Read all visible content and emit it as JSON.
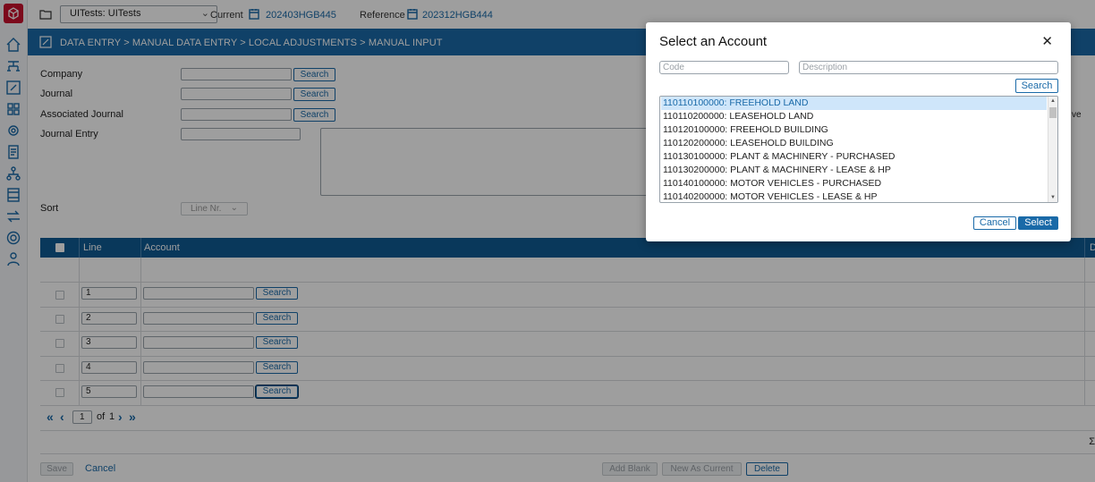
{
  "topbar": {
    "environment": "UITests: UITests",
    "current_label": "Current",
    "current_value": "202403HGB445",
    "reference_label": "Reference",
    "reference_value": "202312HGB444"
  },
  "breadcrumb": "DATA ENTRY > MANUAL DATA ENTRY > LOCAL ADJUSTMENTS > MANUAL INPUT",
  "form": {
    "company_label": "Company",
    "journal_label": "Journal",
    "associated_journal_label": "Associated Journal",
    "journal_entry_label": "Journal Entry",
    "sort_label": "Sort",
    "search_label": "Search",
    "sort_value": "Line Nr.",
    "right_fragment": "ve"
  },
  "grid": {
    "columns": [
      "Line",
      "Account"
    ],
    "rows": [
      {
        "line": "1"
      },
      {
        "line": "2"
      },
      {
        "line": "3"
      },
      {
        "line": "4"
      },
      {
        "line": "5"
      }
    ],
    "row_search_label": "Search",
    "right_col_label": "D",
    "sum_symbol": "Σ"
  },
  "pager": {
    "page": "1",
    "of_label": "of",
    "total": "1"
  },
  "footer": {
    "save": "Save",
    "cancel": "Cancel",
    "add_blank": "Add Blank",
    "new_as_current": "New As Current",
    "delete": "Delete"
  },
  "modal": {
    "title": "Select an Account",
    "code_placeholder": "Code",
    "description_placeholder": "Description",
    "search": "Search",
    "accounts": [
      "110110100000: FREEHOLD LAND",
      "110110200000: LEASEHOLD LAND",
      "110120100000: FREEHOLD BUILDING",
      "110120200000: LEASEHOLD BUILDING",
      "110130100000: PLANT & MACHINERY - PURCHASED",
      "110130200000: PLANT & MACHINERY - LEASE & HP",
      "110140100000: MOTOR VEHICLES - PURCHASED",
      "110140200000: MOTOR VEHICLES - LEASE & HP"
    ],
    "selected_index": 0,
    "cancel": "Cancel",
    "select": "Select"
  },
  "colors": {
    "accent": "#1a6aa8",
    "header_dark": "#0f5b94",
    "brand_red": "#c8102e",
    "selected_row": "#cfe6fa"
  }
}
